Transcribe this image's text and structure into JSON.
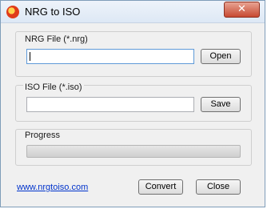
{
  "window": {
    "title": "NRG to  ISO",
    "close_glyph": "✕"
  },
  "nrg": {
    "label": "NRG File (*.nrg)",
    "value": "",
    "button": "Open"
  },
  "iso": {
    "label": "ISO File (*.iso)",
    "value": "",
    "button": "Save"
  },
  "progress": {
    "label": "Progress",
    "value": 0
  },
  "footer": {
    "link": "www.nrgtoiso.com",
    "convert": "Convert",
    "close": "Close"
  }
}
